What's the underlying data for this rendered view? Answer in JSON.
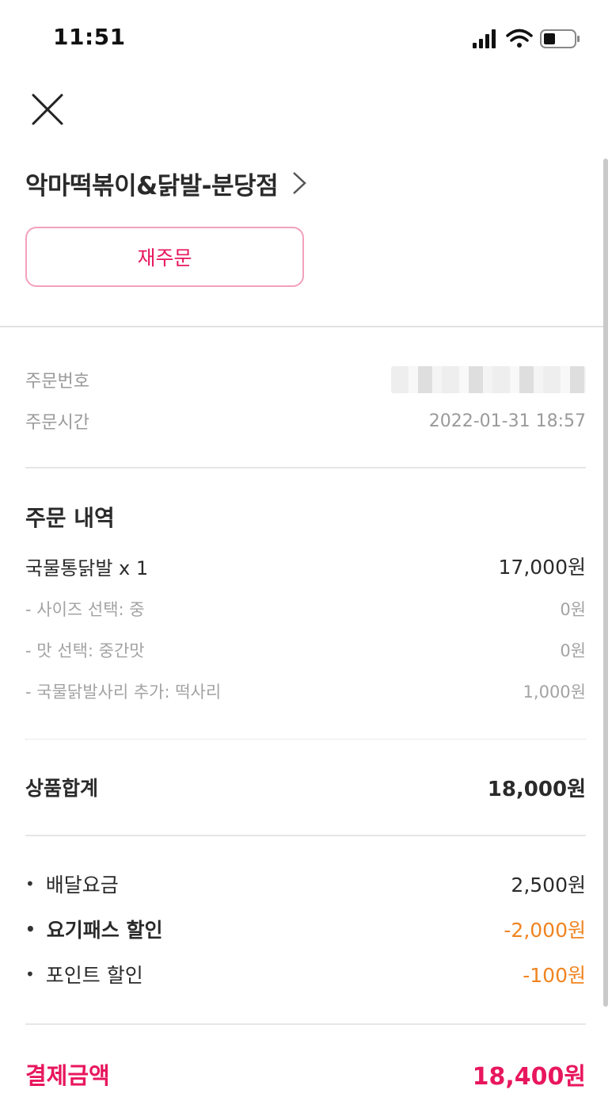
{
  "status_bar": {
    "time": "11:51"
  },
  "header": {
    "store_name": "악마떡볶이&닭발-분당점",
    "reorder_label": "재주문"
  },
  "order_info": {
    "order_number_label": "주문번호",
    "order_time_label": "주문시간",
    "order_time_value": "2022-01-31 18:57"
  },
  "order_details": {
    "title": "주문 내역",
    "main_item": {
      "label": "국물통닭발 x 1",
      "price": "17,000원"
    },
    "options": [
      {
        "label": "- 사이즈 선택: 중",
        "price": "0원"
      },
      {
        "label": "- 맛 선택: 중간맛",
        "price": "0원"
      },
      {
        "label": "- 국물닭발사리 추가: 떡사리",
        "price": "1,000원"
      }
    ]
  },
  "subtotal": {
    "label": "상품합계",
    "value": "18,000원"
  },
  "fees": [
    {
      "label": "배달요금",
      "value": "2,500원"
    },
    {
      "label": "요기패스 할인",
      "value": "-2,000원"
    },
    {
      "label": "포인트 할인",
      "value": "-100원"
    }
  ],
  "total": {
    "label": "결제금액",
    "value": "18,400원"
  },
  "colors": {
    "accent": "#e8175d",
    "discount": "#f08421",
    "border_pink": "#f2a0bd"
  },
  "icons": [
    "signal-icon",
    "wifi-icon",
    "battery-icon",
    "close-icon",
    "chevron-right-icon"
  ]
}
